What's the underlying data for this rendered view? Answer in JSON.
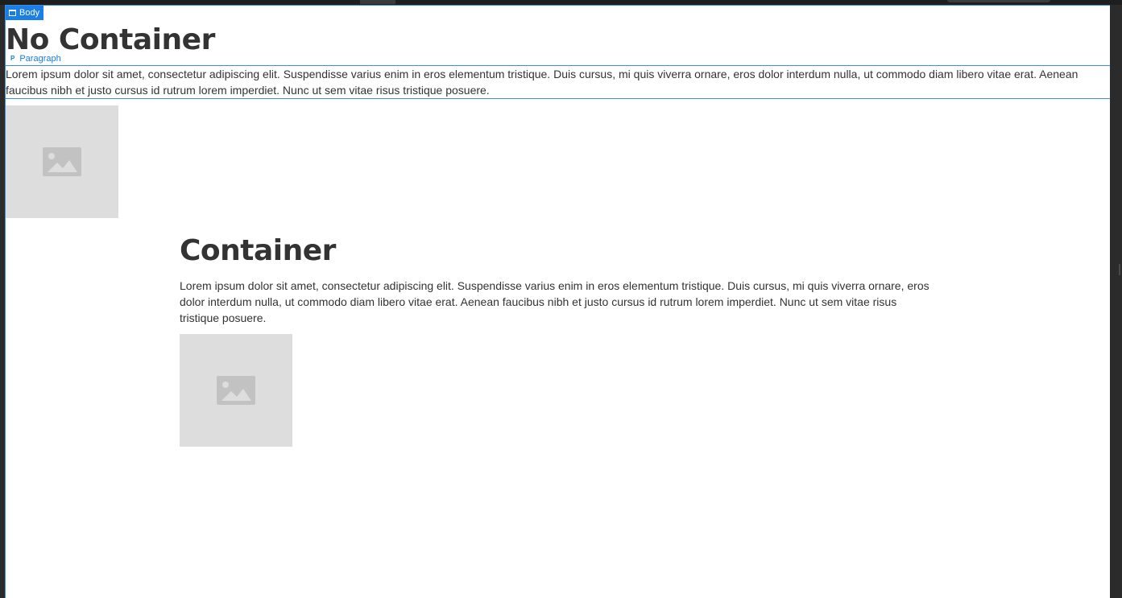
{
  "canvas": {
    "body_badge": "Body",
    "paragraph_badge": "Paragraph"
  },
  "no_container": {
    "heading": "No Container",
    "paragraph": "Lorem ipsum dolor sit amet, consectetur adipiscing elit. Suspendisse varius enim in eros elementum tristique. Duis cursus, mi quis viverra ornare, eros dolor interdum nulla, ut commodo diam libero vitae erat. Aenean faucibus nibh et justo cursus id rutrum lorem imperdiet. Nunc ut sem vitae risus tristique posuere."
  },
  "container": {
    "heading": "Container",
    "paragraph": "Lorem ipsum dolor sit amet, consectetur adipiscing elit. Suspendisse varius enim in eros elementum tristique. Duis cursus, mi quis viverra ornare, eros dolor interdum nulla, ut commodo diam libero vitae erat. Aenean faucibus nibh et justo cursus id rutrum lorem imperdiet. Nunc ut sem vitae risus tristique posuere."
  },
  "icons": {
    "body_badge_icon": "window-icon",
    "paragraph_badge_icon": "paragraph-icon",
    "image_placeholder_icon": "image-icon"
  },
  "colors": {
    "selection_accent": "#1a7ee6",
    "text": "#333333",
    "placeholder_bg": "#dddddd",
    "placeholder_icon": "#c2c2c2"
  }
}
